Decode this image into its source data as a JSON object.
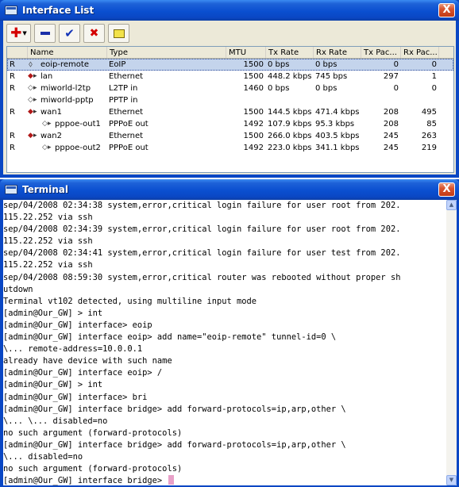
{
  "interface_window": {
    "title": "Interface List",
    "close_label": "X",
    "toolbar": {
      "add_icon": "plus-icon",
      "remove_icon": "minus-icon",
      "enable_icon": "check-icon",
      "disable_icon": "x-icon",
      "comment_icon": "note-icon",
      "add_glyph": "✚",
      "drop_glyph": "▼",
      "enable_glyph": "✔",
      "disable_glyph": "✖"
    },
    "columns": {
      "flag": "",
      "name": "Name",
      "type": "Type",
      "mtu": "MTU",
      "tx_rate": "Tx Rate",
      "rx_rate": "Rx Rate",
      "tx_packets": "Tx Pac...",
      "rx_packets": "Rx Pac..."
    },
    "rows": [
      {
        "flag": "R",
        "name": "eoip-remote",
        "type": "EoIP",
        "mtu": "1500",
        "tx_rate": "0 bps",
        "rx_rate": "0 bps",
        "tx_packets": "0",
        "rx_packets": "0"
      },
      {
        "flag": "R",
        "name": "lan",
        "type": "Ethernet",
        "mtu": "1500",
        "tx_rate": "448.2 kbps",
        "rx_rate": "745 bps",
        "tx_packets": "297",
        "rx_packets": "1"
      },
      {
        "flag": "R",
        "name": "miworld-l2tp",
        "type": "L2TP in",
        "mtu": "1460",
        "tx_rate": "0 bps",
        "rx_rate": "0 bps",
        "tx_packets": "0",
        "rx_packets": "0"
      },
      {
        "flag": "",
        "name": "miworld-pptp",
        "type": "PPTP in",
        "mtu": "",
        "tx_rate": "",
        "rx_rate": "",
        "tx_packets": "",
        "rx_packets": ""
      },
      {
        "flag": "R",
        "name": "wan1",
        "type": "Ethernet",
        "mtu": "1500",
        "tx_rate": "144.5 kbps",
        "rx_rate": "471.4 kbps",
        "tx_packets": "208",
        "rx_packets": "495"
      },
      {
        "flag": "",
        "name": "pppoe-out1",
        "type": "PPPoE out",
        "mtu": "1492",
        "tx_rate": "107.9 kbps",
        "rx_rate": "95.3 kbps",
        "tx_packets": "208",
        "rx_packets": "85"
      },
      {
        "flag": "R",
        "name": "wan2",
        "type": "Ethernet",
        "mtu": "1500",
        "tx_rate": "266.0 kbps",
        "rx_rate": "403.5 kbps",
        "tx_packets": "245",
        "rx_packets": "263"
      },
      {
        "flag": "R",
        "name": "pppoe-out2",
        "type": "PPPoE out",
        "mtu": "1492",
        "tx_rate": "223.0 kbps",
        "rx_rate": "341.1 kbps",
        "tx_packets": "245",
        "rx_packets": "219"
      }
    ]
  },
  "terminal_window": {
    "title": "Terminal",
    "close_label": "X",
    "scroll_up_icon": "scroll-up-arrow-icon",
    "scroll_down_icon": "scroll-down-arrow-icon",
    "lines": [
      "sep/04/2008 02:34:38 system,error,critical login failure for user root from 202.",
      "115.22.252 via ssh",
      "sep/04/2008 02:34:39 system,error,critical login failure for user root from 202.",
      "115.22.252 via ssh",
      "sep/04/2008 02:34:41 system,error,critical login failure for user test from 202.",
      "115.22.252 via ssh",
      "sep/04/2008 08:59:30 system,error,critical router was rebooted without proper sh",
      "utdown",
      "Terminal vt102 detected, using multiline input mode",
      "[admin@Our_GW] > int",
      "[admin@Our_GW] interface> eoip",
      "[admin@Our_GW] interface eoip> add name=\"eoip-remote\" tunnel-id=0 \\",
      "\\... remote-address=10.0.0.1",
      "already have device with such name",
      "[admin@Our_GW] interface eoip> /",
      "[admin@Our_GW] > int",
      "[admin@Our_GW] interface> bri",
      "[admin@Our_GW] interface bridge> add forward-protocols=ip,arp,other \\",
      "\\... \\... disabled=no",
      "no such argument (forward-protocols)",
      "[admin@Our_GW] interface bridge> add forward-protocols=ip,arp,other \\",
      "\\... disabled=no",
      "no such argument (forward-protocols)"
    ],
    "prompt": "[admin@Our_GW] interface bridge> "
  }
}
